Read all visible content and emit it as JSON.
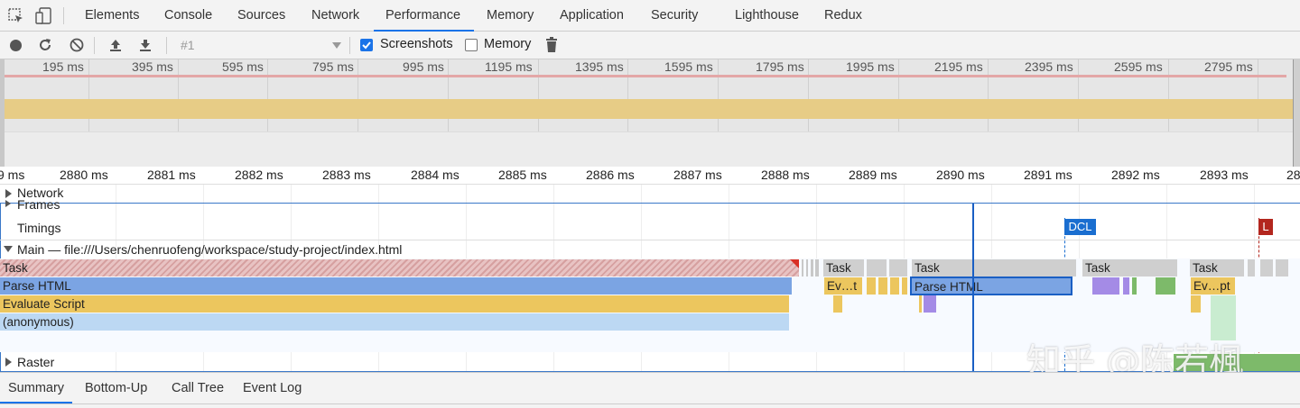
{
  "tabs": [
    {
      "label": "Elements"
    },
    {
      "label": "Console"
    },
    {
      "label": "Sources"
    },
    {
      "label": "Network"
    },
    {
      "label": "Performance",
      "active": true
    },
    {
      "label": "Memory"
    },
    {
      "label": "Application"
    },
    {
      "label": "Security"
    },
    {
      "label": "Lighthouse"
    },
    {
      "label": "Redux"
    }
  ],
  "toolbar": {
    "profile_select": "#1",
    "screenshots_label": "Screenshots",
    "screenshots_checked": true,
    "memory_label": "Memory",
    "memory_checked": false,
    "icons": [
      "record-icon",
      "reload-icon",
      "clear-icon",
      "upload-icon",
      "download-icon",
      "trash-icon"
    ]
  },
  "overview": {
    "ticks": [
      "195 ms",
      "395 ms",
      "595 ms",
      "795 ms",
      "995 ms",
      "1195 ms",
      "1395 ms",
      "1595 ms",
      "1795 ms",
      "1995 ms",
      "2195 ms",
      "2395 ms",
      "2595 ms",
      "2795 ms"
    ]
  },
  "ruler": {
    "ticks": [
      "9 ms",
      "2880 ms",
      "2881 ms",
      "2882 ms",
      "2883 ms",
      "2884 ms",
      "2885 ms",
      "2886 ms",
      "2887 ms",
      "2888 ms",
      "2889 ms",
      "2890 ms",
      "2891 ms",
      "2892 ms",
      "2893 ms",
      "28"
    ]
  },
  "tracks": {
    "network": "Network",
    "frames": "Frames",
    "timings": "Timings",
    "main": "Main — file:///Users/chenruofeng/workspace/study-project/index.html",
    "raster": "Raster"
  },
  "markers": {
    "dcl": "DCL",
    "l": "L"
  },
  "flame": {
    "task": "Task",
    "parse_html": "Parse HTML",
    "evaluate_script": "Evaluate Script",
    "anonymous": "(anonymous)",
    "task_b": "Task",
    "ev_t": "Ev…t",
    "task_c": "Task",
    "parse_html_selected": "Parse HTML",
    "task_d": "Task",
    "task_e": "Task",
    "ev_pt": "Ev…pt"
  },
  "colors": {
    "selection": "#1a73e8",
    "task": "#cfcfcf",
    "long_task_hatch": "#d8a3a3",
    "parse_html": "#7ba4e3",
    "evaluate_script": "#ecc65e",
    "anonymous": "#bcd8f3",
    "dcl": "#1a6ed0",
    "load": "#b3261e",
    "purple": "#a48be6",
    "green": "#7dba6a"
  },
  "bottom_tabs": [
    {
      "label": "Summary",
      "active": true
    },
    {
      "label": "Bottom-Up"
    },
    {
      "label": "Call Tree"
    },
    {
      "label": "Event Log"
    }
  ],
  "watermark": "知乎 @陈若楓"
}
